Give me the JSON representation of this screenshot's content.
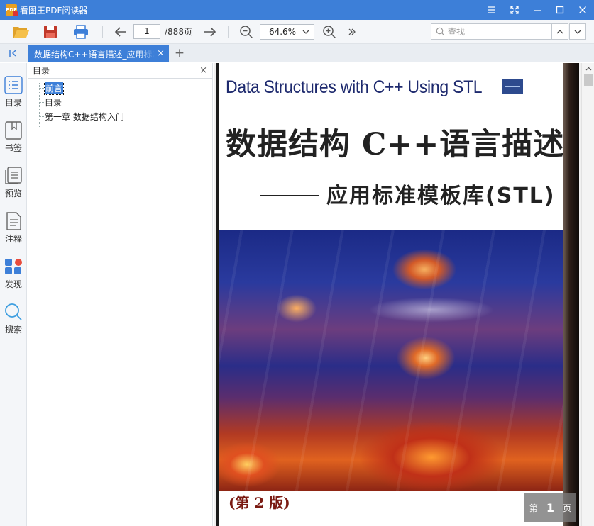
{
  "app": {
    "title": "看图王PDF阅读器",
    "logo_text": "PDF"
  },
  "toolbar": {
    "current_page": "1",
    "total_pages": "/888页",
    "zoom": "64.6%",
    "search_placeholder": "查找"
  },
  "tabs": {
    "active_label": "数据结构C++语言描述_应用标准模板库(STL)",
    "close_glyph": "×",
    "new_tab_glyph": "+"
  },
  "rail": {
    "items": [
      {
        "label": "目录",
        "icon": "outline-icon"
      },
      {
        "label": "书签",
        "icon": "bookmark-icon"
      },
      {
        "label": "预览",
        "icon": "thumbnails-icon"
      },
      {
        "label": "注释",
        "icon": "annotation-icon"
      },
      {
        "label": "发现",
        "icon": "discover-icon"
      },
      {
        "label": "搜索",
        "icon": "search-icon"
      }
    ]
  },
  "panel": {
    "title": "目录",
    "close_glyph": "×",
    "tree": [
      {
        "label": "前言",
        "selected": true
      },
      {
        "label": "目录",
        "selected": false
      },
      {
        "label": "第一章 数据结构入门",
        "selected": false
      }
    ]
  },
  "document": {
    "cover_title_en": "Data Structures with C++ Using STL",
    "cover_title_zh": "数据结构 C++语言描述",
    "cover_subtitle": "应用标准模板库(STL)",
    "cover_edition": "(第 2 版)"
  },
  "page_badge": {
    "prefix": "第",
    "number": "1",
    "suffix": "页"
  },
  "colors": {
    "accent": "#3d7fd8",
    "titlebar": "#3d7fd8",
    "toolbar_bg": "#f4f6f9",
    "discover_dot": "#e84c3d"
  }
}
